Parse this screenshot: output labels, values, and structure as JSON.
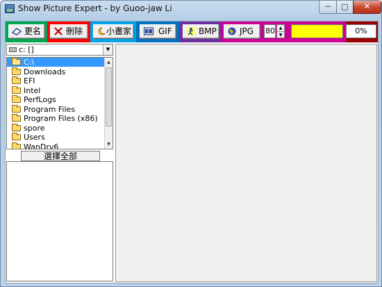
{
  "window": {
    "title": "Show Picture Expert - by Guoo-jaw Li",
    "min_symbol": "─",
    "max_symbol": "□",
    "close_symbol": "✕"
  },
  "toolbar": {
    "rename_label": "更名",
    "delete_label": "刪除",
    "small_picture_label": "小畫家",
    "gif_label": "GIF",
    "bmp_label": "BMP",
    "jpg_label": "JPG",
    "quality_value": "80",
    "progress_text": "0%",
    "segment_colors": [
      "#00a651",
      "#ff0000",
      "#00a2e8",
      "#0070c0",
      "#7030a0",
      "#cc0099",
      "#9b0000"
    ]
  },
  "drive": {
    "label": "c: []",
    "icon": "hard-drive-icon"
  },
  "directories": {
    "items": [
      {
        "label": "C:\\",
        "selected": true
      },
      {
        "label": "Downloads"
      },
      {
        "label": "EFI"
      },
      {
        "label": "Intel"
      },
      {
        "label": "PerfLogs"
      },
      {
        "label": "Program Files"
      },
      {
        "label": "Program Files (x86)"
      },
      {
        "label": "spore"
      },
      {
        "label": "Users"
      },
      {
        "label": "WanDrv6"
      }
    ]
  },
  "select_all_label": "選擇全部"
}
